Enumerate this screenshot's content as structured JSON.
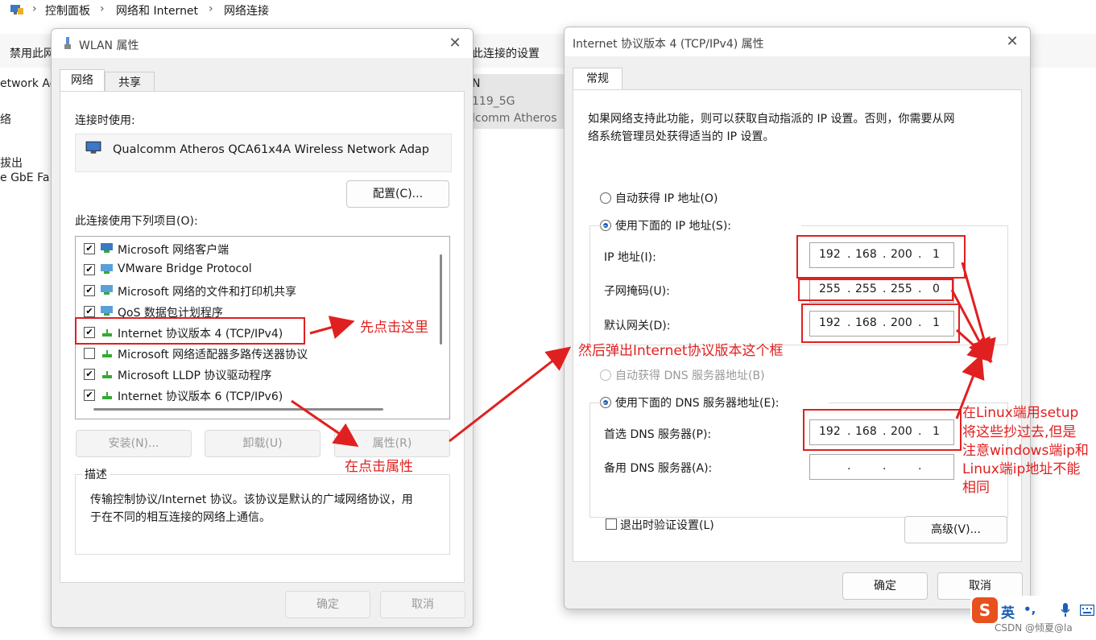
{
  "explorer": {
    "breadcrumb": [
      "控制面板",
      "网络和 Internet",
      "网络连接"
    ],
    "toolbar": {
      "disable": "禁用此网",
      "change_settings": "此连接的设置"
    },
    "left_fragments": [
      "etwork Ad",
      "络",
      "拔出",
      "e GbE Fa"
    ],
    "adapter": {
      "name": "N",
      "ssid": "119_5G",
      "device": "lcomm Atheros"
    }
  },
  "wlan_dialog": {
    "title": "WLAN 属性",
    "tabs": [
      "网络",
      "共享"
    ],
    "connect_using_label": "连接时使用:",
    "adapter_name": "Qualcomm Atheros QCA61x4A Wireless Network Adap",
    "configure_button": "配置(C)...",
    "items_label": "此连接使用下列项目(O):",
    "items": [
      {
        "label": "Microsoft 网络客户端",
        "checked": true
      },
      {
        "label": "VMware Bridge Protocol",
        "checked": true
      },
      {
        "label": "Microsoft 网络的文件和打印机共享",
        "checked": true
      },
      {
        "label": "QoS 数据包计划程序",
        "checked": true
      },
      {
        "label": "Internet 协议版本 4 (TCP/IPv4)",
        "checked": true
      },
      {
        "label": "Microsoft 网络适配器多路传送器协议",
        "checked": false
      },
      {
        "label": "Microsoft LLDP 协议驱动程序",
        "checked": true
      },
      {
        "label": "Internet 协议版本 6 (TCP/IPv6)",
        "checked": true
      }
    ],
    "install_button": "安装(N)...",
    "uninstall_button": "卸载(U)",
    "properties_button": "属性(R)",
    "description_label": "描述",
    "description_text_1": "传输控制协议/Internet 协议。该协议是默认的广域网络协议，用",
    "description_text_2": "于在不同的相互连接的网络上通信。",
    "ok_button": "确定",
    "cancel_button": "取消"
  },
  "ipv4_dialog": {
    "title": "Internet 协议版本 4 (TCP/IPv4) 属性",
    "tab": "常规",
    "intro_1": "如果网络支持此功能，则可以获取自动指派的 IP 设置。否则，你需要从网",
    "intro_2": "络系统管理员处获得适当的 IP 设置。",
    "auto_ip": "自动获得 IP 地址(O)",
    "manual_ip": "使用下面的 IP 地址(S):",
    "ip_label": "IP 地址(I):",
    "ip_value": [
      "192",
      "168",
      "200",
      "1"
    ],
    "mask_label": "子网掩码(U):",
    "mask_value": [
      "255",
      "255",
      "255",
      "0"
    ],
    "gateway_label": "默认网关(D):",
    "gateway_value": [
      "192",
      "168",
      "200",
      "1"
    ],
    "auto_dns": "自动获得 DNS 服务器地址(B)",
    "manual_dns": "使用下面的 DNS 服务器地址(E):",
    "preferred_dns_label": "首选 DNS 服务器(P):",
    "preferred_dns_value": [
      "192",
      "168",
      "200",
      "1"
    ],
    "alternate_dns_label": "备用 DNS 服务器(A):",
    "validate_label": "退出时验证设置(L)",
    "advanced_button": "高级(V)...",
    "ok_button": "确定",
    "cancel_button": "取消"
  },
  "annotations": {
    "click_first": "先点击这里",
    "popup": "然后弹出Internet协议版本这个框",
    "click_properties": "在点击属性",
    "linux_1": "在Linux端用setup",
    "linux_2": "将这些抄过去,但是",
    "linux_3": "注意windows端ip和",
    "linux_4": "Linux端ip地址不能",
    "linux_5": "相同"
  },
  "ime": {
    "lang": "英",
    "punct": "•,",
    "mic": "mic-icon",
    "kbd": "keyboard-icon"
  },
  "watermark": "CSDN @倾夏@la",
  "colors": {
    "annotation_red": "#e02020",
    "radio_blue": "#1a5fb4",
    "dialog_bg": "#f0f0f0"
  }
}
